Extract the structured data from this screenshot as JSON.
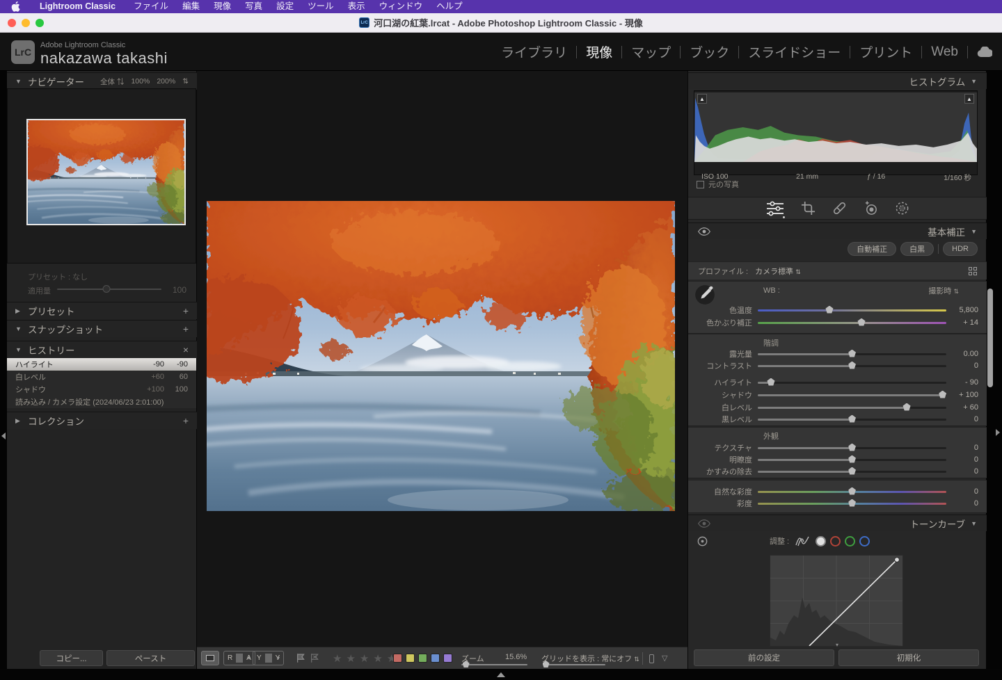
{
  "icons": {
    "triangle_down": "▼",
    "triangle_right": "▶",
    "plus": "+",
    "close": "×",
    "updown": "⇅",
    "star": "★",
    "dropdown": "▽",
    "caret_down": "▾"
  },
  "colors": {
    "menubar": "#5733ac",
    "accent_red": "#ff5f57",
    "accent_yellow": "#febc2e",
    "accent_green": "#28c840",
    "swatch_red": "#c36a63",
    "swatch_yellow": "#cfc75e",
    "swatch_green": "#74ad5c",
    "swatch_blue": "#6a8fd0",
    "swatch_purple": "#967bd4"
  },
  "menu_bar": {
    "items": [
      "Lightroom Classic",
      "ファイル",
      "編集",
      "現像",
      "写真",
      "設定",
      "ツール",
      "表示",
      "ウィンドウ",
      "ヘルプ"
    ]
  },
  "title_bar": {
    "doc_icon": "LrC",
    "title": "河口湖の紅葉.lrcat - Adobe Photoshop Lightroom Classic - 現像"
  },
  "header": {
    "logo": "LrC",
    "app_name": "Adobe Lightroom Classic",
    "identity": "nakazawa takashi",
    "modules": [
      "ライブラリ",
      "現像",
      "マップ",
      "ブック",
      "スライドショー",
      "プリント",
      "Web"
    ],
    "active_module": "現像"
  },
  "left_panel": {
    "navigator": {
      "title": "ナビゲーター",
      "fit": "全体",
      "zoom_100": "100%",
      "zoom_200": "200%"
    },
    "preset_preview": {
      "label": "プリセット : なし",
      "amount_label": "適用量",
      "amount_value": "100",
      "amount_pos": "47%"
    },
    "presets_title": "プリセット",
    "snapshots_title": "スナップショット",
    "history": {
      "title": "ヒストリー",
      "items": [
        {
          "name": "ハイライト",
          "delta": "-90",
          "value": "-90"
        },
        {
          "name": "白レベル",
          "delta": "+60",
          "value": "60"
        },
        {
          "name": "シャドウ",
          "delta": "+100",
          "value": "100"
        },
        {
          "name": "読み込み / カメラ設定 (2024/06/23 2:01:00)",
          "delta": "",
          "value": ""
        }
      ]
    },
    "collections_title": "コレクション",
    "copy_label": "コピー...",
    "paste_label": "ペースト"
  },
  "toolbar": {
    "compare_ra": {
      "left": "R",
      "right": "A"
    },
    "compare_yy": {
      "left": "Y",
      "right": "Y"
    },
    "zoom_label": "ズーム",
    "zoom_value": "15.6%",
    "zoom_pos": "7%",
    "grid_label": "グリッドを表示 :",
    "grid_value": "常にオフ",
    "grid_pos": "5%"
  },
  "right_panel": {
    "histogram": {
      "title": "ヒストグラム",
      "iso": "ISO 100",
      "focal": "21 mm",
      "aperture": "ƒ / 16",
      "shutter": "1/160 秒",
      "original_checkbox": "元の写真"
    },
    "basic": {
      "title": "基本補正",
      "auto_label": "自動補正",
      "bw_label": "白黒",
      "hdr_label": "HDR",
      "profile_label": "プロファイル :",
      "profile_value": "カメラ標準",
      "wb_label": "WB :",
      "wb_value": "撮影時",
      "wb_sliders": [
        {
          "label": "色温度",
          "value": "5,800",
          "pos": "38%"
        },
        {
          "label": "色かぶり補正",
          "value": "+ 14",
          "pos": "55%"
        }
      ],
      "tone_label": "階調",
      "tone_sliders": [
        {
          "label": "露光量",
          "value": "0.00",
          "pos": "50%"
        },
        {
          "label": "コントラスト",
          "value": "0",
          "pos": "50%"
        },
        {
          "label": "ハイライト",
          "value": "- 90",
          "pos": "7%"
        },
        {
          "label": "シャドウ",
          "value": "+ 100",
          "pos": "98%"
        },
        {
          "label": "白レベル",
          "value": "+ 60",
          "pos": "79%"
        },
        {
          "label": "黒レベル",
          "value": "0",
          "pos": "50%"
        }
      ],
      "presence_label": "外観",
      "presence_sliders": [
        {
          "label": "テクスチャ",
          "value": "0",
          "pos": "50%"
        },
        {
          "label": "明瞭度",
          "value": "0",
          "pos": "50%"
        },
        {
          "label": "かすみの除去",
          "value": "0",
          "pos": "50%"
        }
      ],
      "sat_sliders": [
        {
          "label": "自然な彩度",
          "value": "0",
          "pos": "50%"
        },
        {
          "label": "彩度",
          "value": "0",
          "pos": "50%"
        }
      ]
    },
    "tone_curve": {
      "title": "トーンカーブ",
      "adjust_label": "調整 :"
    },
    "footer": {
      "previous": "前の設定",
      "reset": "初期化"
    }
  }
}
